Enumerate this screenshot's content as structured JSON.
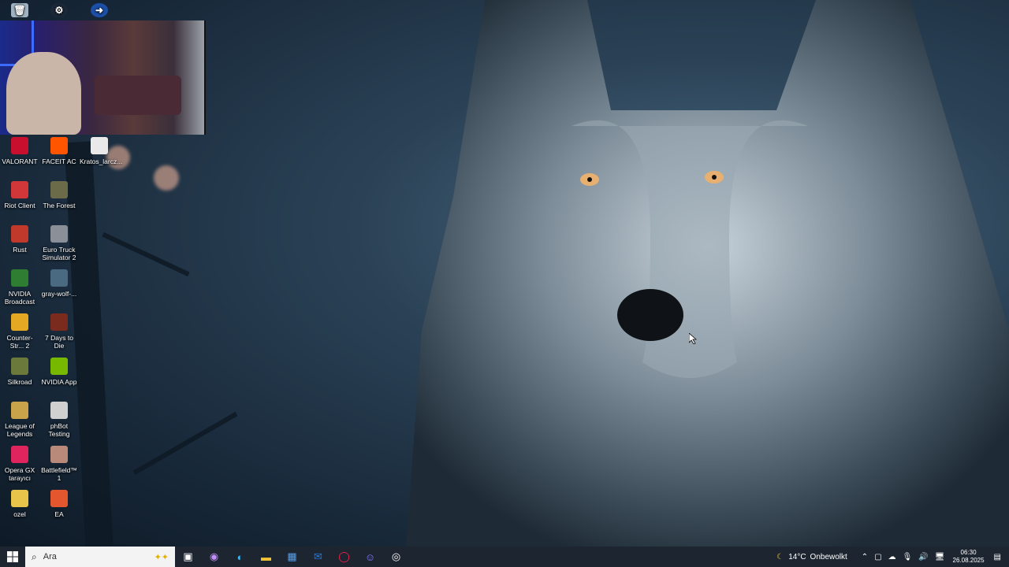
{
  "desktop": {
    "icons": [
      {
        "label": "VALORANT",
        "icon": "valorant-icon",
        "color": "#c8102e"
      },
      {
        "label": "FACEIT AC",
        "icon": "faceit-icon",
        "color": "#ff5500"
      },
      {
        "label": "Kratos_larcz...",
        "icon": "file-icon",
        "color": "#e9e9e9"
      },
      {
        "label": "Riot Client",
        "icon": "riot-icon",
        "color": "#d13639"
      },
      {
        "label": "The Forest",
        "icon": "forest-icon",
        "color": "#6b6b4a"
      },
      {
        "label": "Rust",
        "icon": "rust-icon",
        "color": "#c0392b"
      },
      {
        "label": "Euro Truck Simulator 2",
        "icon": "truck-icon",
        "color": "#8a8f98"
      },
      {
        "label": "NVIDIA Broadcast",
        "icon": "nvidia-broadcast-icon",
        "color": "#2e7d32"
      },
      {
        "label": "gray-wolf-...",
        "icon": "image-file-icon",
        "color": "#4a6a82"
      },
      {
        "label": "Counter-Str... 2",
        "icon": "cs2-icon",
        "color": "#e5a823"
      },
      {
        "label": "7 Days to Die",
        "icon": "7dtd-icon",
        "color": "#7a2b1e"
      },
      {
        "label": "Silkroad",
        "icon": "silkroad-icon",
        "color": "#6b7a3a"
      },
      {
        "label": "NVIDIA App",
        "icon": "nvidia-icon",
        "color": "#76b900"
      },
      {
        "label": "League of Legends",
        "icon": "lol-icon",
        "color": "#c8a34a"
      },
      {
        "label": "phBot Testing",
        "icon": "phbot-icon",
        "color": "#d0d0d0"
      },
      {
        "label": "Opera GX tarayıcı",
        "icon": "opera-gx-icon",
        "color": "#e0245e"
      },
      {
        "label": "Battlefield™ 1",
        "icon": "battlefield-icon",
        "color": "#b98a7a"
      },
      {
        "label": "ozel",
        "icon": "folder-icon",
        "color": "#e8c44a"
      },
      {
        "label": "EA",
        "icon": "ea-icon",
        "color": "#e4572e"
      }
    ],
    "top_icons": [
      {
        "icon": "recycle-bin-icon"
      },
      {
        "icon": "steam-icon"
      },
      {
        "icon": "shortcut-icon"
      }
    ]
  },
  "taskbar": {
    "search_placeholder": "Ara",
    "apps": [
      {
        "icon": "task-view-icon"
      },
      {
        "icon": "copilot-icon"
      },
      {
        "icon": "edge-icon"
      },
      {
        "icon": "file-explorer-icon"
      },
      {
        "icon": "store-icon"
      },
      {
        "icon": "outlook-icon"
      },
      {
        "icon": "opera-gx-icon"
      },
      {
        "icon": "discord-icon"
      },
      {
        "icon": "obs-icon"
      }
    ],
    "weather": {
      "temp": "14°C",
      "condition": "Onbewolkt"
    },
    "clock": {
      "time": "06:30",
      "date": "26.08.2025"
    }
  }
}
